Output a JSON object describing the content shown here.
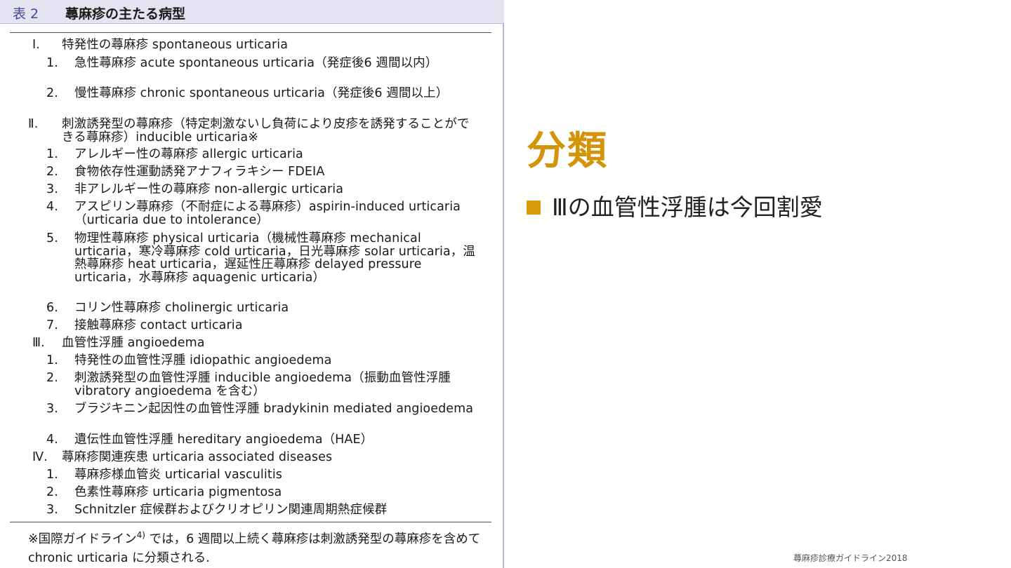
{
  "table": {
    "label": "表 2",
    "title": "蕁麻疹の主たる病型",
    "rows": [
      {
        "num": "Ⅰ.",
        "text": "特発性の蕁麻疹 spontaneous urticaria"
      },
      {
        "num": "1.",
        "text": "急性蕁麻疹 acute spontaneous urticaria（発症後6 週間以内）"
      },
      {
        "num": "2.",
        "text": "慢性蕁麻疹 chronic spontaneous urticaria（発症後6 週間以上）"
      },
      {
        "num": "Ⅱ.",
        "text": "刺激誘発型の蕁麻疹（特定刺激ないし負荷により皮疹を誘発することができる蕁麻疹）inducible urticaria※"
      },
      {
        "num": "1.",
        "text": "アレルギー性の蕁麻疹 allergic urticaria"
      },
      {
        "num": "2.",
        "text": "食物依存性運動誘発アナフィラキシー FDEIA"
      },
      {
        "num": "3.",
        "text": "非アレルギー性の蕁麻疹 non-allergic urticaria"
      },
      {
        "num": "4.",
        "text": "アスピリン蕁麻疹（不耐症による蕁麻疹）aspirin-induced urticaria（urticaria due to intolerance）"
      },
      {
        "num": "5.",
        "text": "物理性蕁麻疹 physical urticaria（機械性蕁麻疹 mechanical urticaria，寒冷蕁麻疹 cold urticaria，日光蕁麻疹 solar urticaria，温熱蕁麻疹 heat urticaria，遅延性圧蕁麻疹 delayed pressure urticaria，水蕁麻疹 aquagenic urticaria）"
      },
      {
        "num": "6.",
        "text": "コリン性蕁麻疹 cholinergic urticaria"
      },
      {
        "num": "7.",
        "text": "接触蕁麻疹 contact urticaria"
      },
      {
        "num": "Ⅲ.",
        "text": "血管性浮腫 angioedema"
      },
      {
        "num": "1.",
        "text": "特発性の血管性浮腫 idiopathic angioedema"
      },
      {
        "num": "2.",
        "text": "刺激誘発型の血管性浮腫 inducible angioedema（振動血管性浮腫 vibratory angioedema を含む）"
      },
      {
        "num": "3.",
        "text": "ブラジキニン起因性の血管性浮腫 bradykinin mediated angioedema"
      },
      {
        "num": "4.",
        "text": "遺伝性血管性浮腫 hereditary angioedema（HAE）"
      },
      {
        "num": "Ⅳ.",
        "text": "蕁麻疹関連疾患 urticaria associated diseases"
      },
      {
        "num": "1.",
        "text": "蕁麻疹様血管炎 urticarial vasculitis"
      },
      {
        "num": "2.",
        "text": "色素性蕁麻疹 urticaria pigmentosa"
      },
      {
        "num": "3.",
        "text": "Schnitzler 症候群およびクリオピリン関連周期熱症候群"
      }
    ],
    "footnote_before": "※国際ガイドライン",
    "footnote_ref": "4)",
    "footnote_after": " では，6 週間以上続く蕁麻疹は刺激誘発型の蕁麻疹を含めて chronic urticaria に分類される."
  },
  "slide": {
    "heading": "分類",
    "bullet": "Ⅲの血管性浮腫は今回割愛",
    "credit": "蕁麻疹診療ガイドライン2018"
  },
  "colors": {
    "heading": "#d4940a",
    "bullet": "#d99a0b",
    "table_header_bg": "#e4e3f2",
    "table_label": "#4a4696"
  }
}
